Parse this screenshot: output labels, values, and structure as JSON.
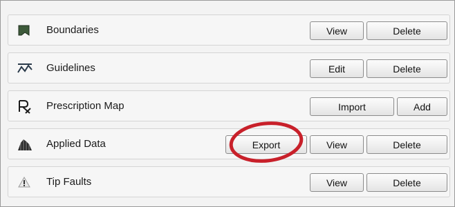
{
  "rows": [
    {
      "label": "Boundaries",
      "icon": "boundary-icon",
      "buttons": [
        "View",
        "Delete"
      ]
    },
    {
      "label": "Guidelines",
      "icon": "guidelines-icon",
      "buttons": [
        "Edit",
        "Delete"
      ]
    },
    {
      "label": "Prescription Map",
      "icon": "prescription-icon",
      "buttons": [
        "Import",
        "Add"
      ]
    },
    {
      "label": "Applied Data",
      "icon": "applied-data-icon",
      "buttons": [
        "Export",
        "View",
        "Delete"
      ]
    },
    {
      "label": "Tip Faults",
      "icon": "warning-icon",
      "buttons": [
        "View",
        "Delete"
      ]
    }
  ],
  "colors": {
    "annotation_circle": "#c8202a"
  }
}
